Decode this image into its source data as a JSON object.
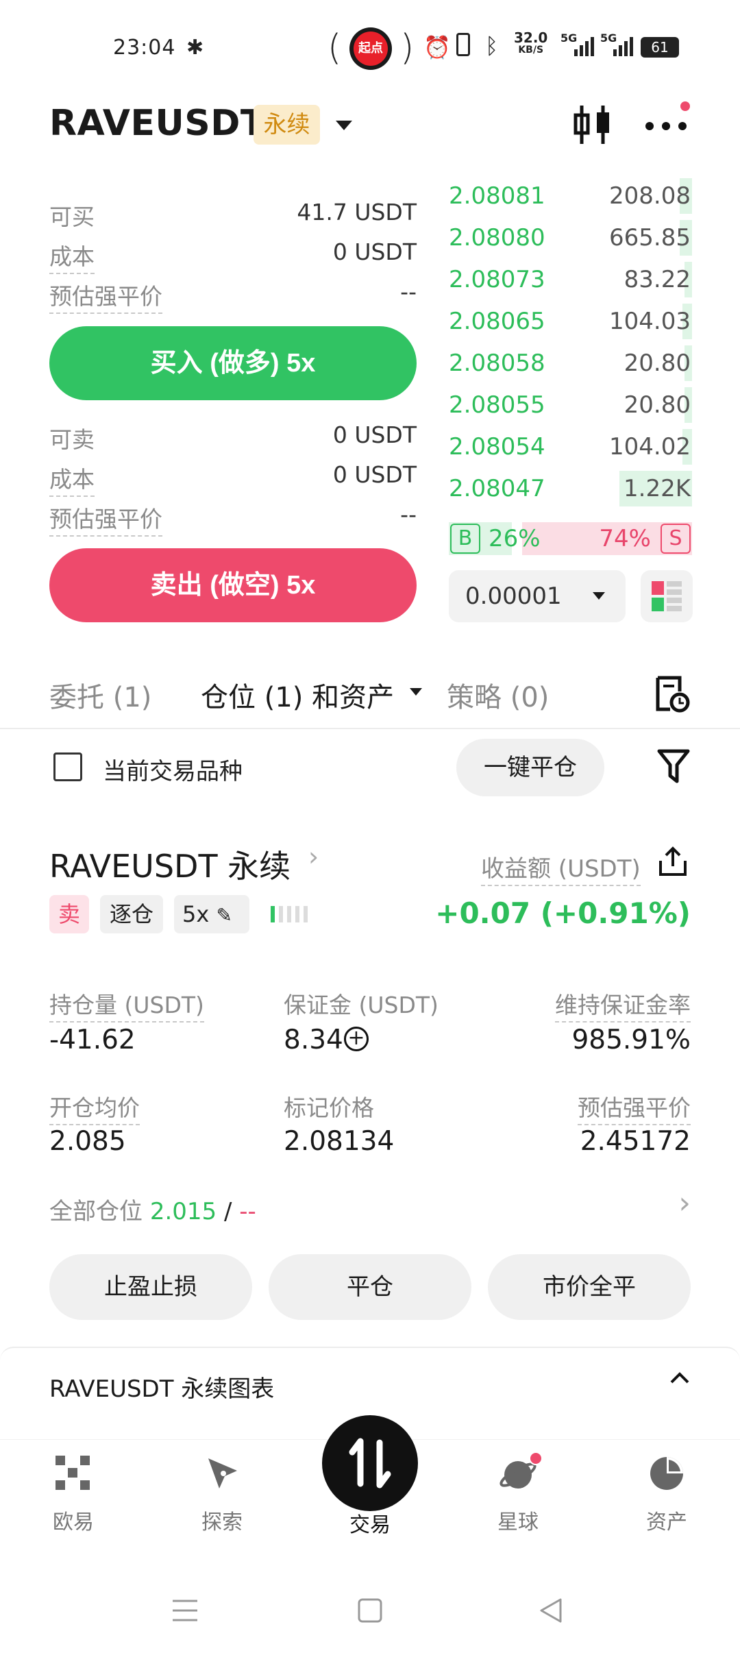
{
  "status_bar": {
    "time": "23:04",
    "badge": "起点",
    "speed": "32.0",
    "speed_unit": "KB/S",
    "net1": "5G",
    "net2": "5G",
    "battery": "61"
  },
  "header": {
    "symbol": "RAVEUSDT",
    "type_badge": "永续"
  },
  "buy_panel": {
    "available_label": "可买",
    "available_value": "41.7 USDT",
    "cost_label": "成本",
    "cost_value": "0 USDT",
    "liq_label": "预估强平价",
    "liq_value": "--",
    "button_label": "买入 (做多) 5x"
  },
  "sell_panel": {
    "available_label": "可卖",
    "available_value": "0 USDT",
    "cost_label": "成本",
    "cost_value": "0 USDT",
    "liq_label": "预估强平价",
    "liq_value": "--",
    "button_label": "卖出 (做空) 5x"
  },
  "order_book": {
    "bids": [
      {
        "price": "2.08081",
        "qty": "208.08",
        "depth": 0.05
      },
      {
        "price": "2.08080",
        "qty": "665.85",
        "depth": 0.05
      },
      {
        "price": "2.08073",
        "qty": "83.22",
        "depth": 0.03
      },
      {
        "price": "2.08065",
        "qty": "104.03",
        "depth": 0.04
      },
      {
        "price": "2.08058",
        "qty": "20.80",
        "depth": 0.03
      },
      {
        "price": "2.08055",
        "qty": "20.80",
        "depth": 0.03
      },
      {
        "price": "2.08054",
        "qty": "104.02",
        "depth": 0.04
      },
      {
        "price": "2.08047",
        "qty": "1.22K",
        "depth": 0.3
      }
    ],
    "buy_label": "B",
    "buy_pct": "26%",
    "sell_pct": "74%",
    "sell_label": "S",
    "precision": "0.00001"
  },
  "tabs": {
    "orders": "委托 (1)",
    "positions": "仓位 (1) 和资产",
    "strategies": "策略 (0)"
  },
  "filter": {
    "current_symbol_label": "当前交易品种",
    "close_all_label": "一键平仓"
  },
  "position": {
    "title": "RAVEUSDT 永续",
    "pnl_label": "收益额 (USDT)",
    "pnl_value": "+0.07 (+0.91%)",
    "side_tag": "卖",
    "margin_mode_tag": "逐仓",
    "leverage_tag": "5x",
    "size_label": "持仓量 (USDT)",
    "size_value": "-41.62",
    "margin_label": "保证金 (USDT)",
    "margin_value": "8.34",
    "mmr_label": "维持保证金率",
    "mmr_value": "985.91%",
    "entry_label": "开仓均价",
    "entry_value": "2.085",
    "mark_label": "标记价格",
    "mark_value": "2.08134",
    "liq_label": "预估强平价",
    "liq_value": "2.45172",
    "all_label": "全部仓位",
    "all_tp": "2.015",
    "all_sep": "/",
    "all_sl": "--",
    "btn_tpsl": "止盈止损",
    "btn_close": "平仓",
    "btn_market_close": "市价全平"
  },
  "chart_panel": {
    "title": "RAVEUSDT 永续图表"
  },
  "bottom_nav": {
    "items": [
      "欧易",
      "探索",
      "交易",
      "星球",
      "资产"
    ]
  },
  "colors": {
    "green": "#31c363",
    "red": "#ee4a6c",
    "badge_bg": "#fbeccb",
    "badge_fg": "#d08a10"
  }
}
